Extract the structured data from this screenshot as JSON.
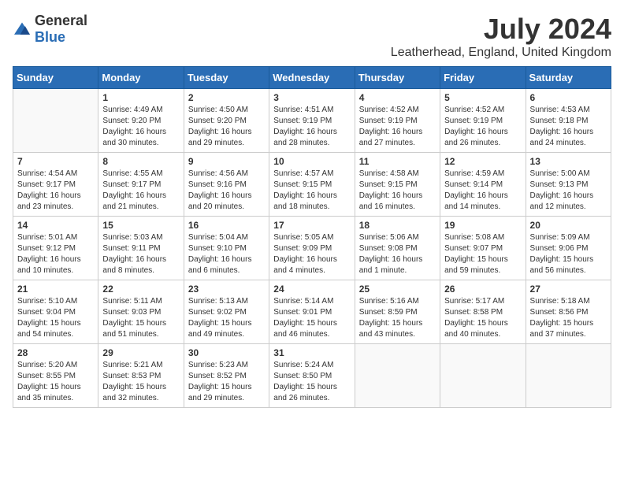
{
  "header": {
    "logo_general": "General",
    "logo_blue": "Blue",
    "month_year": "July 2024",
    "location": "Leatherhead, England, United Kingdom"
  },
  "days_of_week": [
    "Sunday",
    "Monday",
    "Tuesday",
    "Wednesday",
    "Thursday",
    "Friday",
    "Saturday"
  ],
  "weeks": [
    [
      {
        "day": "",
        "info": ""
      },
      {
        "day": "1",
        "info": "Sunrise: 4:49 AM\nSunset: 9:20 PM\nDaylight: 16 hours\nand 30 minutes."
      },
      {
        "day": "2",
        "info": "Sunrise: 4:50 AM\nSunset: 9:20 PM\nDaylight: 16 hours\nand 29 minutes."
      },
      {
        "day": "3",
        "info": "Sunrise: 4:51 AM\nSunset: 9:19 PM\nDaylight: 16 hours\nand 28 minutes."
      },
      {
        "day": "4",
        "info": "Sunrise: 4:52 AM\nSunset: 9:19 PM\nDaylight: 16 hours\nand 27 minutes."
      },
      {
        "day": "5",
        "info": "Sunrise: 4:52 AM\nSunset: 9:19 PM\nDaylight: 16 hours\nand 26 minutes."
      },
      {
        "day": "6",
        "info": "Sunrise: 4:53 AM\nSunset: 9:18 PM\nDaylight: 16 hours\nand 24 minutes."
      }
    ],
    [
      {
        "day": "7",
        "info": "Sunrise: 4:54 AM\nSunset: 9:17 PM\nDaylight: 16 hours\nand 23 minutes."
      },
      {
        "day": "8",
        "info": "Sunrise: 4:55 AM\nSunset: 9:17 PM\nDaylight: 16 hours\nand 21 minutes."
      },
      {
        "day": "9",
        "info": "Sunrise: 4:56 AM\nSunset: 9:16 PM\nDaylight: 16 hours\nand 20 minutes."
      },
      {
        "day": "10",
        "info": "Sunrise: 4:57 AM\nSunset: 9:15 PM\nDaylight: 16 hours\nand 18 minutes."
      },
      {
        "day": "11",
        "info": "Sunrise: 4:58 AM\nSunset: 9:15 PM\nDaylight: 16 hours\nand 16 minutes."
      },
      {
        "day": "12",
        "info": "Sunrise: 4:59 AM\nSunset: 9:14 PM\nDaylight: 16 hours\nand 14 minutes."
      },
      {
        "day": "13",
        "info": "Sunrise: 5:00 AM\nSunset: 9:13 PM\nDaylight: 16 hours\nand 12 minutes."
      }
    ],
    [
      {
        "day": "14",
        "info": "Sunrise: 5:01 AM\nSunset: 9:12 PM\nDaylight: 16 hours\nand 10 minutes."
      },
      {
        "day": "15",
        "info": "Sunrise: 5:03 AM\nSunset: 9:11 PM\nDaylight: 16 hours\nand 8 minutes."
      },
      {
        "day": "16",
        "info": "Sunrise: 5:04 AM\nSunset: 9:10 PM\nDaylight: 16 hours\nand 6 minutes."
      },
      {
        "day": "17",
        "info": "Sunrise: 5:05 AM\nSunset: 9:09 PM\nDaylight: 16 hours\nand 4 minutes."
      },
      {
        "day": "18",
        "info": "Sunrise: 5:06 AM\nSunset: 9:08 PM\nDaylight: 16 hours\nand 1 minute."
      },
      {
        "day": "19",
        "info": "Sunrise: 5:08 AM\nSunset: 9:07 PM\nDaylight: 15 hours\nand 59 minutes."
      },
      {
        "day": "20",
        "info": "Sunrise: 5:09 AM\nSunset: 9:06 PM\nDaylight: 15 hours\nand 56 minutes."
      }
    ],
    [
      {
        "day": "21",
        "info": "Sunrise: 5:10 AM\nSunset: 9:04 PM\nDaylight: 15 hours\nand 54 minutes."
      },
      {
        "day": "22",
        "info": "Sunrise: 5:11 AM\nSunset: 9:03 PM\nDaylight: 15 hours\nand 51 minutes."
      },
      {
        "day": "23",
        "info": "Sunrise: 5:13 AM\nSunset: 9:02 PM\nDaylight: 15 hours\nand 49 minutes."
      },
      {
        "day": "24",
        "info": "Sunrise: 5:14 AM\nSunset: 9:01 PM\nDaylight: 15 hours\nand 46 minutes."
      },
      {
        "day": "25",
        "info": "Sunrise: 5:16 AM\nSunset: 8:59 PM\nDaylight: 15 hours\nand 43 minutes."
      },
      {
        "day": "26",
        "info": "Sunrise: 5:17 AM\nSunset: 8:58 PM\nDaylight: 15 hours\nand 40 minutes."
      },
      {
        "day": "27",
        "info": "Sunrise: 5:18 AM\nSunset: 8:56 PM\nDaylight: 15 hours\nand 37 minutes."
      }
    ],
    [
      {
        "day": "28",
        "info": "Sunrise: 5:20 AM\nSunset: 8:55 PM\nDaylight: 15 hours\nand 35 minutes."
      },
      {
        "day": "29",
        "info": "Sunrise: 5:21 AM\nSunset: 8:53 PM\nDaylight: 15 hours\nand 32 minutes."
      },
      {
        "day": "30",
        "info": "Sunrise: 5:23 AM\nSunset: 8:52 PM\nDaylight: 15 hours\nand 29 minutes."
      },
      {
        "day": "31",
        "info": "Sunrise: 5:24 AM\nSunset: 8:50 PM\nDaylight: 15 hours\nand 26 minutes."
      },
      {
        "day": "",
        "info": ""
      },
      {
        "day": "",
        "info": ""
      },
      {
        "day": "",
        "info": ""
      }
    ]
  ]
}
